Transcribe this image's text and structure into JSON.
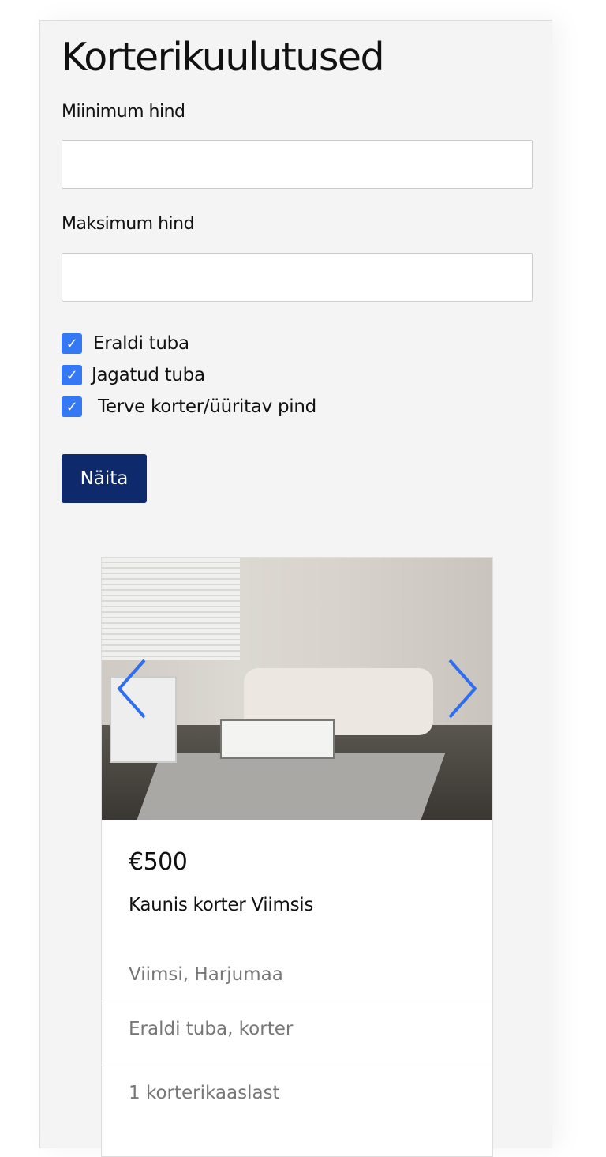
{
  "page_title": "Korterikuulutused",
  "filters": {
    "min_price_label": "Miinimum hind",
    "min_price_value": "",
    "max_price_label": "Maksimum hind",
    "max_price_value": "",
    "checkboxes": [
      {
        "label": "Eraldi tuba",
        "checked": true
      },
      {
        "label": "Jagatud tuba",
        "checked": true
      },
      {
        "label": "Terve korter/üüritav pind",
        "checked": true
      }
    ],
    "submit_label": "Näita"
  },
  "listing": {
    "price": "€500",
    "title": "Kaunis korter Viimsis",
    "location": "Viimsi, Harjumaa",
    "type": "Eraldi tuba, korter",
    "roommates": "1 korterikaaslast"
  },
  "colors": {
    "accent": "#3478f6",
    "button": "#0e2a6c"
  }
}
